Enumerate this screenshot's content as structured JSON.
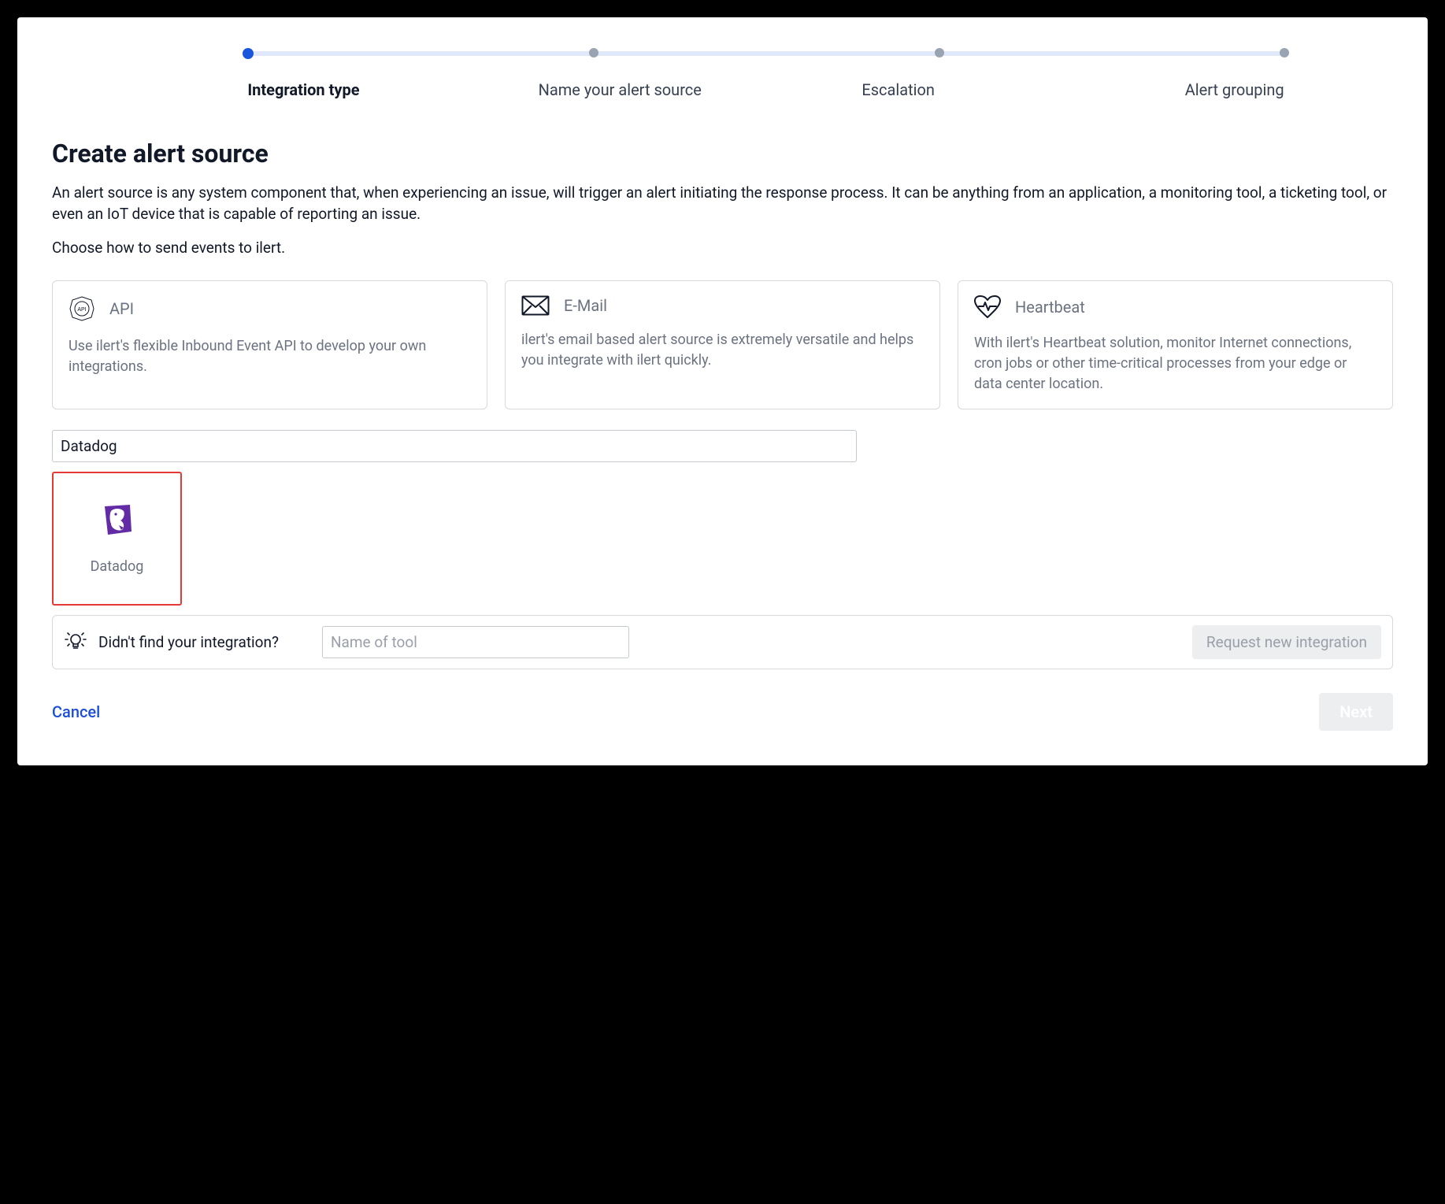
{
  "stepper": {
    "steps": [
      {
        "label": "Integration type",
        "active": true
      },
      {
        "label": "Name your alert source",
        "active": false
      },
      {
        "label": "Escalation",
        "active": false
      },
      {
        "label": "Alert grouping",
        "active": false
      }
    ]
  },
  "page": {
    "title": "Create alert source",
    "description": "An alert source is any system component that, when experiencing an issue, will trigger an alert initiating the response process. It can be anything from an application, a monitoring tool, a ticketing tool, or even an IoT device that is capable of reporting an issue.",
    "instruction": "Choose how to send events to ilert."
  },
  "cards": [
    {
      "icon": "api-icon",
      "title": "API",
      "body": "Use ilert's flexible Inbound Event API to develop your own integrations."
    },
    {
      "icon": "envelope-icon",
      "title": "E-Mail",
      "body": "ilert's email based alert source is extremely versatile and helps you integrate with ilert quickly."
    },
    {
      "icon": "heartbeat-icon",
      "title": "Heartbeat",
      "body": "With ilert's Heartbeat solution, monitor Internet connections, cron jobs or other time-critical processes from your edge or data center location."
    }
  ],
  "search": {
    "value": "Datadog"
  },
  "result": {
    "label": "Datadog",
    "icon": "datadog-icon"
  },
  "suggest": {
    "question": "Didn't find your integration?",
    "placeholder": "Name of tool",
    "button": "Request new integration"
  },
  "footer": {
    "cancel": "Cancel",
    "next": "Next"
  }
}
